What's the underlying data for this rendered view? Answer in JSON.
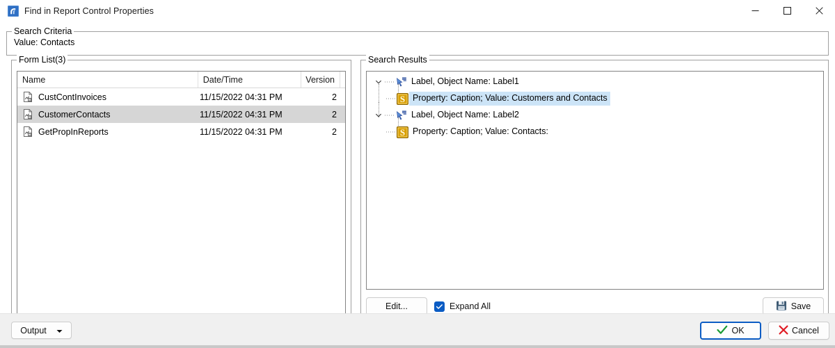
{
  "window": {
    "title": "Find in Report Control Properties",
    "app_icon": "report-app-icon",
    "controls": {
      "minimize": "minimize-icon",
      "maximize": "maximize-icon",
      "close": "close-icon"
    }
  },
  "search_criteria": {
    "group_title": "Search Criteria",
    "value_text": "Value: Contacts"
  },
  "form_list": {
    "group_title": "Form List(3)",
    "columns": [
      "Name",
      "Date/Time",
      "Version"
    ],
    "rows": [
      {
        "name": "CustContInvoices",
        "datetime": "11/15/2022 04:31 PM",
        "version": "2",
        "selected": false
      },
      {
        "name": "CustomerContacts",
        "datetime": "11/15/2022 04:31 PM",
        "version": "2",
        "selected": true
      },
      {
        "name": "GetPropInReports",
        "datetime": "11/15/2022 04:31 PM",
        "version": "2",
        "selected": false
      }
    ]
  },
  "search_results": {
    "group_title": "Search Results",
    "tree": [
      {
        "level": 0,
        "icon": "label-control-icon",
        "expanded": true,
        "text": "Label, Object Name: Label1",
        "selected": false
      },
      {
        "level": 1,
        "icon": "string-property-icon",
        "expanded": false,
        "text": "Property: Caption; Value: Customers and Contacts",
        "selected": true
      },
      {
        "level": 0,
        "icon": "label-control-icon",
        "expanded": true,
        "text": "Label, Object Name: Label2",
        "selected": false
      },
      {
        "level": 1,
        "icon": "string-property-icon",
        "expanded": false,
        "text": "Property: Caption; Value: Contacts:",
        "selected": false
      }
    ],
    "toolbar": {
      "edit_label": "Edit...",
      "expand_all_label": "Expand All",
      "expand_all_checked": true,
      "save_label": "Save",
      "save_icon": "floppy-disk-icon"
    }
  },
  "bottom_bar": {
    "output_label": "Output",
    "output_caret": "chevron-down-icon",
    "ok_label": "OK",
    "ok_icon": "green-check-icon",
    "cancel_label": "Cancel",
    "cancel_icon": "red-x-icon"
  },
  "colors": {
    "selection_tree": "#cce4f7",
    "selection_list": "#d6d6d6",
    "accent": "#0b5cc4",
    "ok_check": "#1a9c33",
    "cancel_x": "#e01b24",
    "property_icon": "#d9a006"
  }
}
